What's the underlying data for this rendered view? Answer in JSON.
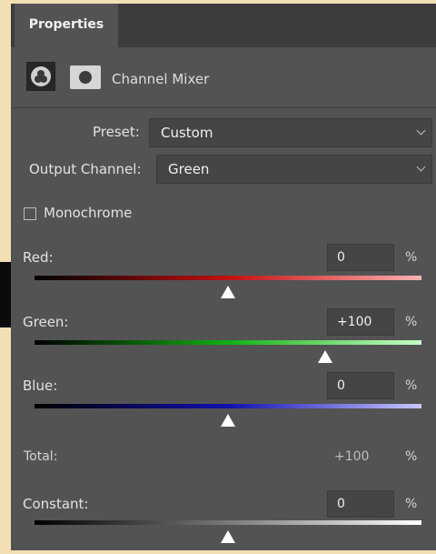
{
  "tab": {
    "label": "Properties"
  },
  "header": {
    "title": "Channel Mixer",
    "adjustment_icon": "channel-mixer-icon",
    "mask_icon": "layer-mask-icon"
  },
  "preset": {
    "label": "Preset:",
    "value": "Custom"
  },
  "output_channel": {
    "label": "Output Channel:",
    "value": "Green"
  },
  "monochrome": {
    "label": "Monochrome",
    "checked": false
  },
  "sliders": [
    {
      "label": "Red:",
      "value": "0",
      "unit": "%",
      "level": 0,
      "gradient": [
        "#000000",
        "#c01010",
        "#ffb0b0"
      ]
    },
    {
      "label": "Green:",
      "value": "+100",
      "unit": "%",
      "level": 100,
      "gradient": [
        "#000000",
        "#12b012",
        "#c8ffc8"
      ]
    },
    {
      "label": "Blue:",
      "value": "0",
      "unit": "%",
      "level": 0,
      "gradient": [
        "#000000",
        "#1010b0",
        "#c8c8ff"
      ]
    }
  ],
  "total": {
    "label": "Total:",
    "value": "+100",
    "unit": "%"
  },
  "constant": {
    "label": "Constant:",
    "value": "0",
    "unit": "%",
    "level": 0,
    "gradient": [
      "#000000",
      "#7a7a7a",
      "#ffffff"
    ]
  }
}
